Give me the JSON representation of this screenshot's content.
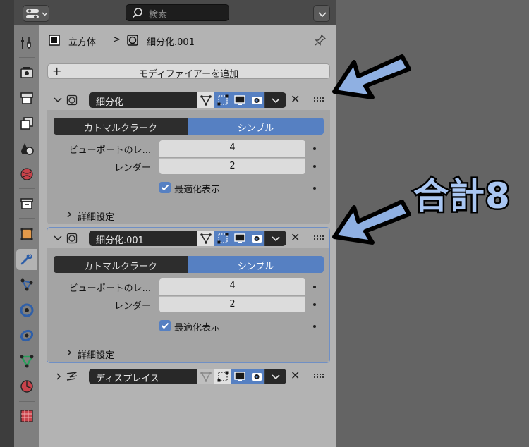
{
  "header": {
    "search_placeholder": "検索"
  },
  "breadcrumb": {
    "object": "立方体",
    "separator": ">",
    "modifier": "細分化.001"
  },
  "toolbar": {
    "add_modifier_label": "モディファイアーを追加"
  },
  "modifiers": [
    {
      "name": "細分化",
      "expanded": true,
      "algorithm": {
        "option_left": "カトマルクラーク",
        "option_right": "シンプル",
        "selected": "シンプル"
      },
      "viewport_label": "ビューポートのレ...",
      "viewport_value": "4",
      "render_label": "レンダー",
      "render_value": "2",
      "optimal_label": "最適化表示",
      "optimal_checked": true,
      "advanced_label": "詳細設定"
    },
    {
      "name": "細分化.001",
      "expanded": true,
      "active": true,
      "algorithm": {
        "option_left": "カトマルクラーク",
        "option_right": "シンプル",
        "selected": "シンプル"
      },
      "viewport_label": "ビューポートのレ...",
      "viewport_value": "4",
      "render_label": "レンダー",
      "render_value": "2",
      "optimal_label": "最適化表示",
      "optimal_checked": true,
      "advanced_label": "詳細設定"
    },
    {
      "name": "ディスプレイス",
      "expanded": false
    }
  ],
  "annotation": {
    "text": "合計8",
    "color": "#a9c6f2"
  },
  "colors": {
    "accent": "#5680c2",
    "panel": "#b3b3b3",
    "field_dark": "#282828"
  }
}
